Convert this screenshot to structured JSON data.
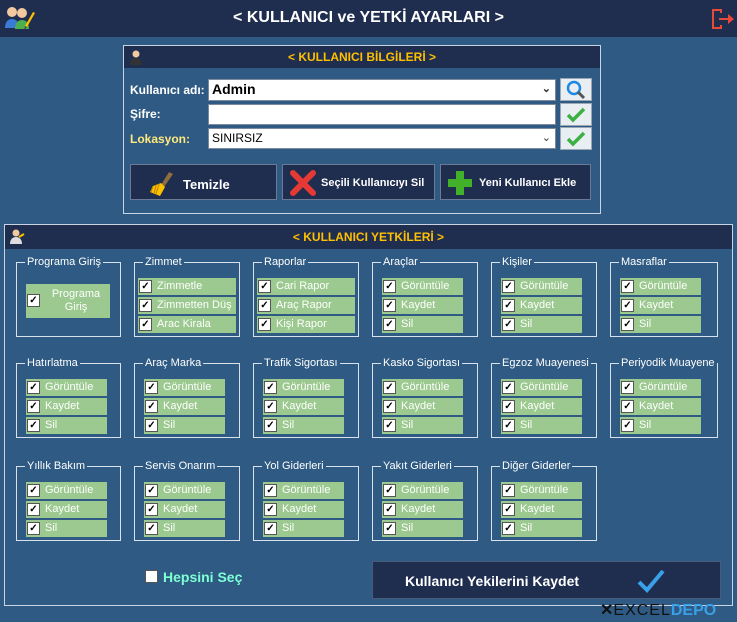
{
  "window": {
    "title": "< KULLANICI ve YETKİ AYARLARI >"
  },
  "user_info": {
    "header": "< KULLANICI BİLGİLERİ >",
    "username_label": "Kullanıcı adı:",
    "username_value": "Admin",
    "password_label": "Şifre:",
    "password_value": "",
    "location_label": "Lokasyon:",
    "location_value": "SINIRSIZ",
    "clear_button": "Temizle",
    "delete_button": "Seçili Kullanıcıyı Sil",
    "add_button": "Yeni Kullanıcı Ekle"
  },
  "permissions": {
    "header": "< KULLANICI YETKİLERİ >",
    "groups": [
      {
        "title": "Programa Giriş",
        "items": [
          {
            "label": "Programa Giriş",
            "checked": true
          }
        ]
      },
      {
        "title": "Zimmet",
        "items": [
          {
            "label": "Zimmetle",
            "checked": true
          },
          {
            "label": "Zimmetten Düş",
            "checked": true
          },
          {
            "label": "Arac Kirala",
            "checked": true
          }
        ]
      },
      {
        "title": "Raporlar",
        "items": [
          {
            "label": "Cari Rapor",
            "checked": true
          },
          {
            "label": "Araç Rapor",
            "checked": true
          },
          {
            "label": "Kişi Rapor",
            "checked": true
          }
        ]
      },
      {
        "title": "Araçlar",
        "items": [
          {
            "label": "Görüntüle",
            "checked": true
          },
          {
            "label": "Kaydet",
            "checked": true
          },
          {
            "label": "Sil",
            "checked": true
          }
        ]
      },
      {
        "title": "Kişiler",
        "items": [
          {
            "label": "Görüntüle",
            "checked": true
          },
          {
            "label": "Kaydet",
            "checked": true
          },
          {
            "label": "Sil",
            "checked": true
          }
        ]
      },
      {
        "title": "Masraflar",
        "items": [
          {
            "label": "Görüntüle",
            "checked": true
          },
          {
            "label": "Kaydet",
            "checked": true
          },
          {
            "label": "Sil",
            "checked": true
          }
        ]
      },
      {
        "title": "Hatırlatma",
        "items": [
          {
            "label": "Görüntüle",
            "checked": true
          },
          {
            "label": "Kaydet",
            "checked": true
          },
          {
            "label": "Sil",
            "checked": true
          }
        ]
      },
      {
        "title": "Araç Marka",
        "items": [
          {
            "label": "Görüntüle",
            "checked": true
          },
          {
            "label": "Kaydet",
            "checked": true
          },
          {
            "label": "Sil",
            "checked": true
          }
        ]
      },
      {
        "title": "Trafik Sigortası",
        "items": [
          {
            "label": "Görüntüle",
            "checked": true
          },
          {
            "label": "Kaydet",
            "checked": true
          },
          {
            "label": "Sil",
            "checked": true
          }
        ]
      },
      {
        "title": "Kasko Sigortası",
        "items": [
          {
            "label": "Görüntüle",
            "checked": true
          },
          {
            "label": "Kaydet",
            "checked": true
          },
          {
            "label": "Sil",
            "checked": true
          }
        ]
      },
      {
        "title": "Egzoz Muayenesi",
        "items": [
          {
            "label": "Görüntüle",
            "checked": true
          },
          {
            "label": "Kaydet",
            "checked": true
          },
          {
            "label": "Sil",
            "checked": true
          }
        ]
      },
      {
        "title": "Periyodik Muayene",
        "items": [
          {
            "label": "Görüntüle",
            "checked": true
          },
          {
            "label": "Kaydet",
            "checked": true
          },
          {
            "label": "Sil",
            "checked": true
          }
        ]
      },
      {
        "title": "Yıllık Bakım",
        "items": [
          {
            "label": "Görüntüle",
            "checked": true
          },
          {
            "label": "Kaydet",
            "checked": true
          },
          {
            "label": "Sil",
            "checked": true
          }
        ]
      },
      {
        "title": "Servis Onarım",
        "items": [
          {
            "label": "Görüntüle",
            "checked": true
          },
          {
            "label": "Kaydet",
            "checked": true
          },
          {
            "label": "Sil",
            "checked": true
          }
        ]
      },
      {
        "title": "Yol Giderleri",
        "items": [
          {
            "label": "Görüntüle",
            "checked": true
          },
          {
            "label": "Kaydet",
            "checked": true
          },
          {
            "label": "Sil",
            "checked": true
          }
        ]
      },
      {
        "title": "Yakıt Giderleri",
        "items": [
          {
            "label": "Görüntüle",
            "checked": true
          },
          {
            "label": "Kaydet",
            "checked": true
          },
          {
            "label": "Sil",
            "checked": true
          }
        ]
      },
      {
        "title": "Diğer Giderler",
        "items": [
          {
            "label": "Görüntüle",
            "checked": true
          },
          {
            "label": "Kaydet",
            "checked": true
          },
          {
            "label": "Sil",
            "checked": true
          }
        ]
      }
    ],
    "select_all_label": "Hepsini Seç",
    "select_all_checked": false,
    "save_button": "Kullanıcı Yekilerini Kaydet"
  },
  "branding": {
    "logo_text_1": "EXCEL",
    "logo_text_2": "DEPO"
  },
  "colors": {
    "title_bar": "#1F2D4F",
    "background": "#2E5A83",
    "accent_yellow": "#FFC000",
    "item_green": "#9BC98F",
    "select_all_text": "#7FFFD4",
    "check_blue": "#3AA0E8"
  }
}
